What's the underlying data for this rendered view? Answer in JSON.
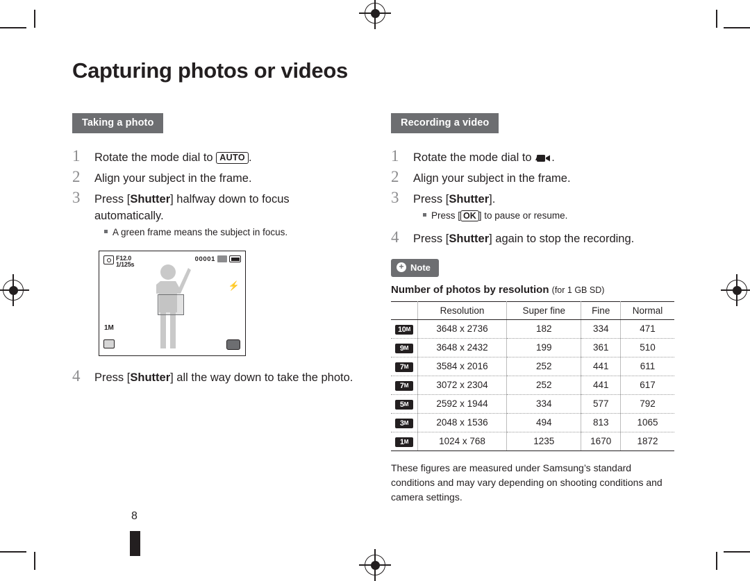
{
  "document": {
    "title": "Capturing photos or videos",
    "page_number": "8"
  },
  "left_column": {
    "section_title": "Taking a photo",
    "steps": [
      {
        "num": "1",
        "text_before": "Rotate the mode dial to ",
        "badge": "AUTO",
        "text_after": "."
      },
      {
        "num": "2",
        "text_before": "Align your subject in the frame.",
        "badge": "",
        "text_after": ""
      },
      {
        "num": "3",
        "text_before": "Press [",
        "badge": "Shutter",
        "text_after": "] halfway down to focus automatically."
      },
      {
        "num": "4",
        "text_before": "Press [",
        "badge": "Shutter",
        "text_after": "] all the way down to take the photo."
      }
    ],
    "bullet": "A green frame means the subject in focus.",
    "camera_screen": {
      "aperture": "F12.0",
      "shutter_speed": "1/125s",
      "shots_remaining": "00001",
      "card_label": "",
      "flash_label": "⚡",
      "resolution_label": "1M"
    }
  },
  "right_column": {
    "section_title": "Recording a video",
    "steps": [
      {
        "num": "1",
        "text_before": "Rotate the mode dial to ",
        "badge": "movie-icon",
        "text_after": "."
      },
      {
        "num": "2",
        "text_before": "Align your subject in the frame.",
        "badge": "",
        "text_after": ""
      },
      {
        "num": "3",
        "text_before": "Press [",
        "badge": "Shutter",
        "text_after": "]."
      },
      {
        "num": "4",
        "text_before": "Press [",
        "badge": "Shutter",
        "text_after": "] again to stop the recording."
      }
    ],
    "bullet_before": "Press [",
    "bullet_badge": "OK",
    "bullet_after": "] to pause or resume.",
    "note_label": "Note",
    "note_plus": "+",
    "table_title": "Number of photos by resolution",
    "table_title_small": "(for 1 GB SD)",
    "table": {
      "headers": [
        "",
        "Resolution",
        "Super fine",
        "Fine",
        "Normal"
      ],
      "rows": [
        {
          "icon": "10",
          "icon_sub": "M",
          "resolution": "3648 x 2736",
          "super_fine": "182",
          "fine": "334",
          "normal": "471"
        },
        {
          "icon": "9",
          "icon_sub": "M",
          "resolution": "3648 x 2432",
          "super_fine": "199",
          "fine": "361",
          "normal": "510"
        },
        {
          "icon": "7",
          "icon_sub": "M",
          "resolution": "3584 x 2016",
          "super_fine": "252",
          "fine": "441",
          "normal": "611"
        },
        {
          "icon": "7",
          "icon_sub": "M",
          "resolution": "3072 x 2304",
          "super_fine": "252",
          "fine": "441",
          "normal": "617"
        },
        {
          "icon": "5",
          "icon_sub": "M",
          "resolution": "2592 x 1944",
          "super_fine": "334",
          "fine": "577",
          "normal": "792"
        },
        {
          "icon": "3",
          "icon_sub": "M",
          "resolution": "2048 x 1536",
          "super_fine": "494",
          "fine": "813",
          "normal": "1065"
        },
        {
          "icon": "1",
          "icon_sub": "M",
          "resolution": "1024 x 768",
          "super_fine": "1235",
          "fine": "1670",
          "normal": "1872"
        }
      ]
    },
    "footnote": "These figures are measured under Samsung’s standard conditions and may vary depending on shooting conditions and camera settings."
  },
  "colors": {
    "accent_gray": "#6d6e71",
    "text": "#231f20",
    "num_gray": "#8c8c8e"
  }
}
